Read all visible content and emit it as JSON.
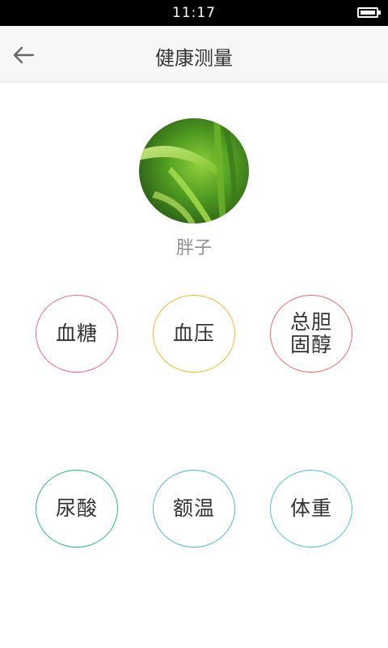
{
  "status_bar": {
    "time": "11:17",
    "battery_icon": "battery-full-icon"
  },
  "nav": {
    "back_icon": "arrow-left-icon",
    "title": "健康测量"
  },
  "profile": {
    "name": "胖子",
    "avatar_image": "green bamboo leaves"
  },
  "measurements": [
    {
      "label": "血糖",
      "color": "#e8679a"
    },
    {
      "label": "血压",
      "color": "#f2b731"
    },
    {
      "label": "总胆固醇",
      "color": "#ec6a6a"
    },
    {
      "label": "尿酸",
      "color": "#2fb58a"
    },
    {
      "label": "额温",
      "color": "#4fb8d8"
    },
    {
      "label": "体重",
      "color": "#4fc2d0"
    }
  ]
}
